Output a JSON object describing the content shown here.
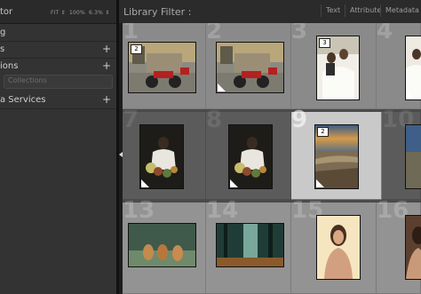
{
  "left_panel": {
    "navigator_title": "tor",
    "zoom_options": [
      "FIT ⇕",
      "100%",
      "6.3% ⇕"
    ],
    "rows": [
      {
        "label": "g",
        "has_plus": false
      },
      {
        "label": "s",
        "has_plus": true
      },
      {
        "label": "ions",
        "has_plus": true
      },
      {
        "label": "a Services",
        "has_plus": true
      }
    ],
    "smart_collections": "Collections"
  },
  "filter_bar": {
    "title": "Library Filter :",
    "tabs": [
      "Text",
      "Attribute",
      "Metadata"
    ]
  },
  "grid": {
    "cells": [
      {
        "number": "1",
        "badge": "2",
        "has_corner": false,
        "photo": "motorcycle"
      },
      {
        "number": "2",
        "badge": "",
        "has_corner": true,
        "photo": "motorcycle"
      },
      {
        "number": "3",
        "badge": "3",
        "has_corner": false,
        "photo": "couple"
      },
      {
        "number": "4",
        "badge": "",
        "has_corner": true,
        "photo": "couple-partial"
      },
      {
        "number": "7",
        "badge": "",
        "has_corner": true,
        "photo": "woman-flowers"
      },
      {
        "number": "8",
        "badge": "",
        "has_corner": true,
        "photo": "woman-flowers"
      },
      {
        "number": "9",
        "badge": "2",
        "has_corner": true,
        "photo": "seascape"
      },
      {
        "number": "10",
        "badge": "",
        "has_corner": false,
        "photo": "seascape-partial"
      },
      {
        "number": "13",
        "badge": "",
        "has_corner": false,
        "photo": "dogs"
      },
      {
        "number": "14",
        "badge": "",
        "has_corner": false,
        "photo": "forest"
      },
      {
        "number": "15",
        "badge": "",
        "has_corner": false,
        "photo": "woman-portrait"
      },
      {
        "number": "16",
        "badge": "",
        "has_corner": false,
        "photo": "woman-partial"
      }
    ]
  }
}
